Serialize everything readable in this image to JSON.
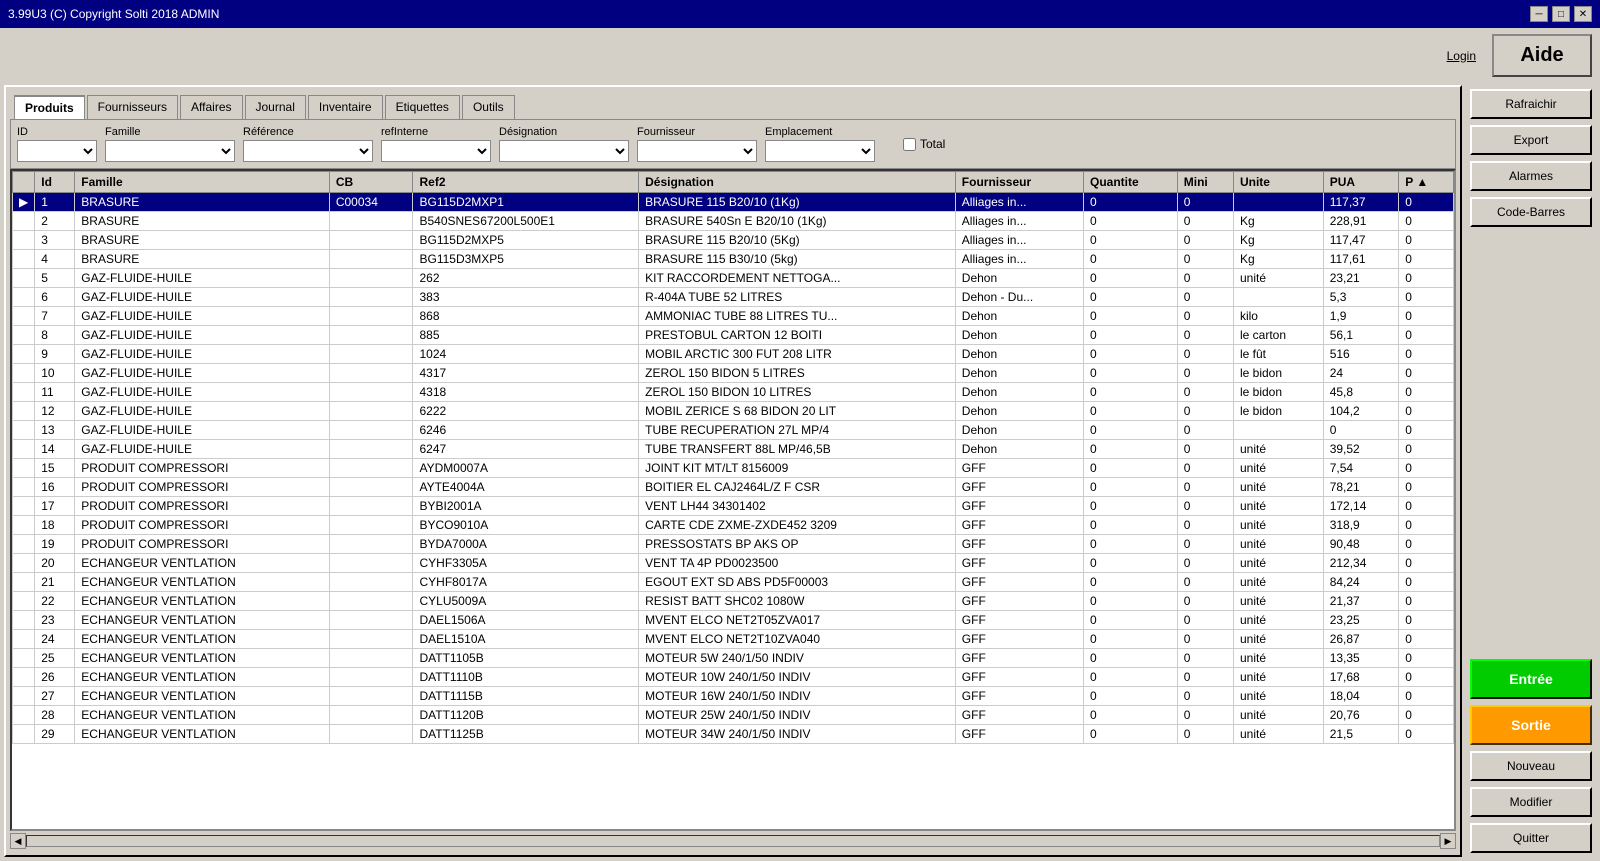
{
  "titleBar": {
    "title": "3.99U3 (C) Copyright Solti  2018  ADMIN",
    "minimize": "─",
    "maximize": "□",
    "close": "✕"
  },
  "topRight": {
    "loginLabel": "Login",
    "aideLabel": "Aide"
  },
  "tabs": [
    {
      "label": "Produits",
      "active": true
    },
    {
      "label": "Fournisseurs",
      "active": false
    },
    {
      "label": "Affaires",
      "active": false
    },
    {
      "label": "Journal",
      "active": false
    },
    {
      "label": "Inventaire",
      "active": false
    },
    {
      "label": "Etiquettes",
      "active": false
    },
    {
      "label": "Outils",
      "active": false
    }
  ],
  "filters": {
    "idLabel": "ID",
    "familleLabel": "Famille",
    "referenceLabel": "Référence",
    "refInterneLabel": "refInterne",
    "designationLabel": "Désignation",
    "fournisseurLabel": "Fournisseur",
    "emplacementLabel": "Emplacement",
    "totalLabel": "Total"
  },
  "tableHeaders": [
    "",
    "Id",
    "Famille",
    "CB",
    "Ref2",
    "Désignation",
    "Fournisseur",
    "Quantite",
    "Mini",
    "Unite",
    "PUA",
    "P"
  ],
  "rows": [
    {
      "id": "1",
      "famille": "BRASURE",
      "cb": "C00034",
      "ref2": "BG115D2MXP1",
      "designation": "BRASURE 115 B20/10 (1Kg)",
      "fournisseur": "Alliages in...",
      "quantite": "0",
      "mini": "0",
      "unite": "",
      "pua": "117,37",
      "p": "0",
      "selected": true
    },
    {
      "id": "2",
      "famille": "BRASURE",
      "cb": "",
      "ref2": "B540SNES67200L500E1",
      "designation": "BRASURE 540Sn E B20/10 (1Kg)",
      "fournisseur": "Alliages in...",
      "quantite": "0",
      "mini": "0",
      "unite": "Kg",
      "pua": "228,91",
      "p": "0",
      "selected": false
    },
    {
      "id": "3",
      "famille": "BRASURE",
      "cb": "",
      "ref2": "BG115D2MXP5",
      "designation": "BRASURE 115 B20/10 (5Kg)",
      "fournisseur": "Alliages in...",
      "quantite": "0",
      "mini": "0",
      "unite": "Kg",
      "pua": "117,47",
      "p": "0",
      "selected": false
    },
    {
      "id": "4",
      "famille": "BRASURE",
      "cb": "",
      "ref2": "BG115D3MXP5",
      "designation": "BRASURE 115 B30/10 (5kg)",
      "fournisseur": "Alliages in...",
      "quantite": "0",
      "mini": "0",
      "unite": "Kg",
      "pua": "117,61",
      "p": "0",
      "selected": false
    },
    {
      "id": "5",
      "famille": "GAZ-FLUIDE-HUILE",
      "cb": "",
      "ref2": "262",
      "designation": "KIT RACCORDEMENT NETTOGA...",
      "fournisseur": "Dehon",
      "quantite": "0",
      "mini": "0",
      "unite": "unité",
      "pua": "23,21",
      "p": "0",
      "selected": false
    },
    {
      "id": "6",
      "famille": "GAZ-FLUIDE-HUILE",
      "cb": "",
      "ref2": "383",
      "designation": "R-404A TUBE 52 LITRES",
      "fournisseur": "Dehon - Du...",
      "quantite": "0",
      "mini": "0",
      "unite": "",
      "pua": "5,3",
      "p": "0",
      "selected": false
    },
    {
      "id": "7",
      "famille": "GAZ-FLUIDE-HUILE",
      "cb": "",
      "ref2": "868",
      "designation": "AMMONIAC TUBE 88 LITRES TU...",
      "fournisseur": "Dehon",
      "quantite": "0",
      "mini": "0",
      "unite": "kilo",
      "pua": "1,9",
      "p": "0",
      "selected": false
    },
    {
      "id": "8",
      "famille": "GAZ-FLUIDE-HUILE",
      "cb": "",
      "ref2": "885",
      "designation": "PRESTOBUL  CARTON 12 BOITI",
      "fournisseur": "Dehon",
      "quantite": "0",
      "mini": "0",
      "unite": "le carton",
      "pua": "56,1",
      "p": "0",
      "selected": false
    },
    {
      "id": "9",
      "famille": "GAZ-FLUIDE-HUILE",
      "cb": "",
      "ref2": "1024",
      "designation": "MOBIL ARCTIC 300  FUT 208 LITR",
      "fournisseur": "Dehon",
      "quantite": "0",
      "mini": "0",
      "unite": "le fût",
      "pua": "516",
      "p": "0",
      "selected": false
    },
    {
      "id": "10",
      "famille": "GAZ-FLUIDE-HUILE",
      "cb": "",
      "ref2": "4317",
      "designation": "ZEROL 150 BIDON 5 LITRES",
      "fournisseur": "Dehon",
      "quantite": "0",
      "mini": "0",
      "unite": "le bidon",
      "pua": "24",
      "p": "0",
      "selected": false
    },
    {
      "id": "11",
      "famille": "GAZ-FLUIDE-HUILE",
      "cb": "",
      "ref2": "4318",
      "designation": "ZEROL 150 BIDON 10 LITRES",
      "fournisseur": "Dehon",
      "quantite": "0",
      "mini": "0",
      "unite": "le bidon",
      "pua": "45,8",
      "p": "0",
      "selected": false
    },
    {
      "id": "12",
      "famille": "GAZ-FLUIDE-HUILE",
      "cb": "",
      "ref2": "6222",
      "designation": "MOBIL ZERICE S 68 BIDON 20 LIT",
      "fournisseur": "Dehon",
      "quantite": "0",
      "mini": "0",
      "unite": "le bidon",
      "pua": "104,2",
      "p": "0",
      "selected": false
    },
    {
      "id": "13",
      "famille": "GAZ-FLUIDE-HUILE",
      "cb": "",
      "ref2": "6246",
      "designation": "TUBE RECUPERATION 27L MP/4",
      "fournisseur": "Dehon",
      "quantite": "0",
      "mini": "0",
      "unite": "",
      "pua": "0",
      "p": "0",
      "selected": false
    },
    {
      "id": "14",
      "famille": "GAZ-FLUIDE-HUILE",
      "cb": "",
      "ref2": "6247",
      "designation": "TUBE TRANSFERT 88L MP/46,5B",
      "fournisseur": "Dehon",
      "quantite": "0",
      "mini": "0",
      "unite": "unité",
      "pua": "39,52",
      "p": "0",
      "selected": false
    },
    {
      "id": "15",
      "famille": "PRODUIT COMPRESSORI",
      "cb": "",
      "ref2": "AYDM0007A",
      "designation": "JOINT KIT MT/LT 8156009",
      "fournisseur": "GFF",
      "quantite": "0",
      "mini": "0",
      "unite": "unité",
      "pua": "7,54",
      "p": "0",
      "selected": false
    },
    {
      "id": "16",
      "famille": "PRODUIT COMPRESSORI",
      "cb": "",
      "ref2": "AYTE4004A",
      "designation": "BOITIER EL CAJ2464L/Z F CSR",
      "fournisseur": "GFF",
      "quantite": "0",
      "mini": "0",
      "unite": "unité",
      "pua": "78,21",
      "p": "0",
      "selected": false
    },
    {
      "id": "17",
      "famille": "PRODUIT COMPRESSORI",
      "cb": "",
      "ref2": "BYBI2001A",
      "designation": "VENT LH44 34301402",
      "fournisseur": "GFF",
      "quantite": "0",
      "mini": "0",
      "unite": "unité",
      "pua": "172,14",
      "p": "0",
      "selected": false
    },
    {
      "id": "18",
      "famille": "PRODUIT COMPRESSORI",
      "cb": "",
      "ref2": "BYCO9010A",
      "designation": "CARTE CDE ZXME-ZXDE452 3209",
      "fournisseur": "GFF",
      "quantite": "0",
      "mini": "0",
      "unite": "unité",
      "pua": "318,9",
      "p": "0",
      "selected": false
    },
    {
      "id": "19",
      "famille": "PRODUIT COMPRESSORI",
      "cb": "",
      "ref2": "BYDA7000A",
      "designation": "PRESSOSTATS BP AKS OP",
      "fournisseur": "GFF",
      "quantite": "0",
      "mini": "0",
      "unite": "unité",
      "pua": "90,48",
      "p": "0",
      "selected": false
    },
    {
      "id": "20",
      "famille": "ECHANGEUR VENTLATION",
      "cb": "",
      "ref2": "CYHF3305A",
      "designation": "VENT TA 4P PD0023500",
      "fournisseur": "GFF",
      "quantite": "0",
      "mini": "0",
      "unite": "unité",
      "pua": "212,34",
      "p": "0",
      "selected": false
    },
    {
      "id": "21",
      "famille": "ECHANGEUR VENTLATION",
      "cb": "",
      "ref2": "CYHF8017A",
      "designation": "EGOUT EXT SD ABS PD5F00003",
      "fournisseur": "GFF",
      "quantite": "0",
      "mini": "0",
      "unite": "unité",
      "pua": "84,24",
      "p": "0",
      "selected": false
    },
    {
      "id": "22",
      "famille": "ECHANGEUR VENTLATION",
      "cb": "",
      "ref2": "CYLU5009A",
      "designation": "RESIST BATT SHC02 1080W",
      "fournisseur": "GFF",
      "quantite": "0",
      "mini": "0",
      "unite": "unité",
      "pua": "21,37",
      "p": "0",
      "selected": false
    },
    {
      "id": "23",
      "famille": "ECHANGEUR VENTLATION",
      "cb": "",
      "ref2": "DAEL1506A",
      "designation": "MVENT ELCO NET2T05ZVA017",
      "fournisseur": "GFF",
      "quantite": "0",
      "mini": "0",
      "unite": "unité",
      "pua": "23,25",
      "p": "0",
      "selected": false
    },
    {
      "id": "24",
      "famille": "ECHANGEUR VENTLATION",
      "cb": "",
      "ref2": "DAEL1510A",
      "designation": "MVENT ELCO NET2T10ZVA040",
      "fournisseur": "GFF",
      "quantite": "0",
      "mini": "0",
      "unite": "unité",
      "pua": "26,87",
      "p": "0",
      "selected": false
    },
    {
      "id": "25",
      "famille": "ECHANGEUR VENTLATION",
      "cb": "",
      "ref2": "DATT1105B",
      "designation": "MOTEUR 5W 240/1/50 INDIV",
      "fournisseur": "GFF",
      "quantite": "0",
      "mini": "0",
      "unite": "unité",
      "pua": "13,35",
      "p": "0",
      "selected": false
    },
    {
      "id": "26",
      "famille": "ECHANGEUR VENTLATION",
      "cb": "",
      "ref2": "DATT1110B",
      "designation": "MOTEUR 10W 240/1/50 INDIV",
      "fournisseur": "GFF",
      "quantite": "0",
      "mini": "0",
      "unite": "unité",
      "pua": "17,68",
      "p": "0",
      "selected": false
    },
    {
      "id": "27",
      "famille": "ECHANGEUR VENTLATION",
      "cb": "",
      "ref2": "DATT1115B",
      "designation": "MOTEUR 16W 240/1/50 INDIV",
      "fournisseur": "GFF",
      "quantite": "0",
      "mini": "0",
      "unite": "unité",
      "pua": "18,04",
      "p": "0",
      "selected": false
    },
    {
      "id": "28",
      "famille": "ECHANGEUR VENTLATION",
      "cb": "",
      "ref2": "DATT1120B",
      "designation": "MOTEUR 25W 240/1/50 INDIV",
      "fournisseur": "GFF",
      "quantite": "0",
      "mini": "0",
      "unite": "unité",
      "pua": "20,76",
      "p": "0",
      "selected": false
    },
    {
      "id": "29",
      "famille": "ECHANGEUR VENTLATION",
      "cb": "",
      "ref2": "DATT1125B",
      "designation": "MOTEUR 34W 240/1/50 INDIV",
      "fournisseur": "GFF",
      "quantite": "0",
      "mini": "0",
      "unite": "unité",
      "pua": "21,5",
      "p": "0",
      "selected": false
    }
  ],
  "rightButtons": {
    "rafraichir": "Rafraichir",
    "export": "Export",
    "alarmes": "Alarmes",
    "codeBarres": "Code-Barres",
    "entree": "Entrée",
    "sortie": "Sortie",
    "nouveau": "Nouveau",
    "modifier": "Modifier",
    "quitter": "Quitter"
  }
}
